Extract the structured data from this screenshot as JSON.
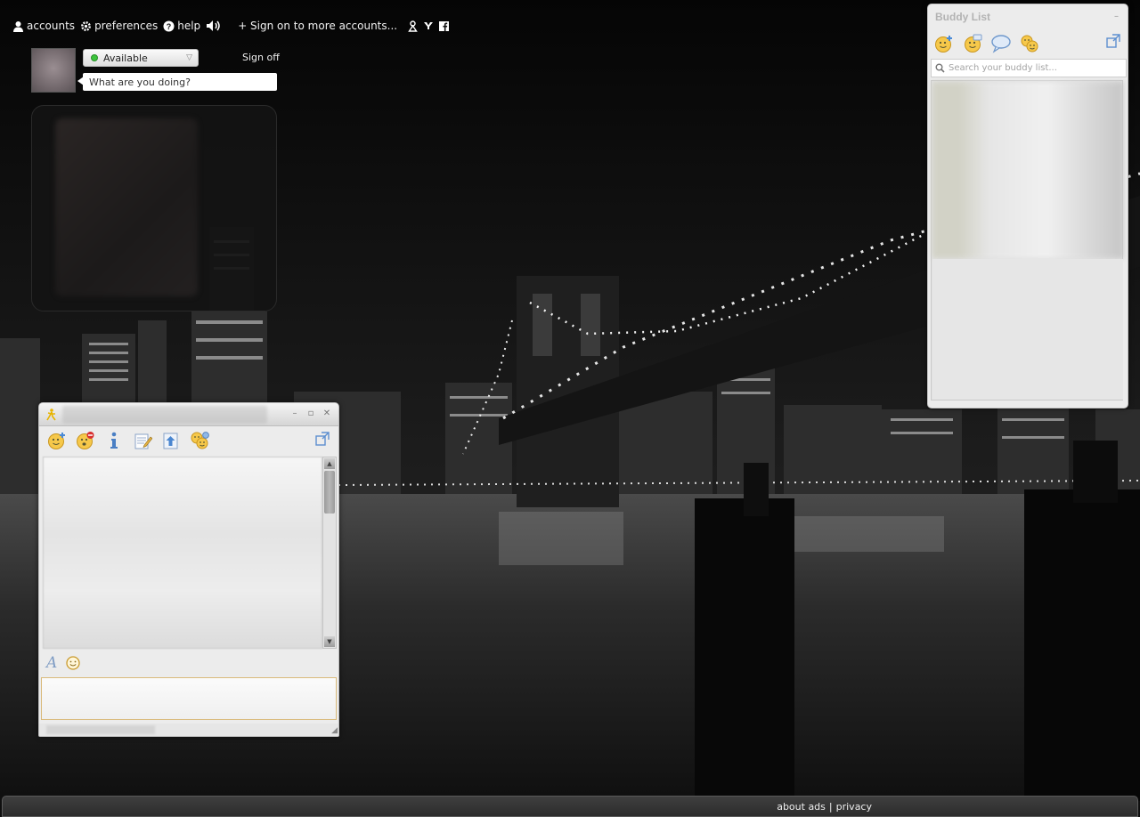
{
  "topbar": {
    "accounts_label": "accounts",
    "preferences_label": "preferences",
    "help_label": "help",
    "sign_on_label": "+ Sign on to more accounts..."
  },
  "profile": {
    "status_label": "Available",
    "status_color": "#3cc43c",
    "signoff_label": "Sign off",
    "status_message_placeholder": "What are you doing?"
  },
  "chat_window": {
    "compose_value": ""
  },
  "buddy_list": {
    "title": "Buddy List",
    "search_placeholder": "Search your buddy list..."
  },
  "footer": {
    "about_ads_label": "about ads",
    "separator": "|",
    "privacy_label": "privacy"
  },
  "icons": {
    "topbar": [
      "person-icon",
      "gear-icon",
      "help-icon",
      "speaker-icon",
      "aim-buddy-icon",
      "yahoo-icon",
      "facebook-icon"
    ],
    "chat_toolbar": [
      "add-buddy-icon",
      "block-icon",
      "info-icon",
      "notes-icon",
      "send-file-icon",
      "group-chat-icon",
      "popout-icon"
    ],
    "buddy_toolbar": [
      "add-buddy-icon",
      "add-group-icon",
      "im-bubble-icon",
      "group-chat-icon",
      "popout-icon"
    ]
  },
  "colors": {
    "accent_icon": "#f0b43a",
    "compose_border": "#d9b97a"
  }
}
